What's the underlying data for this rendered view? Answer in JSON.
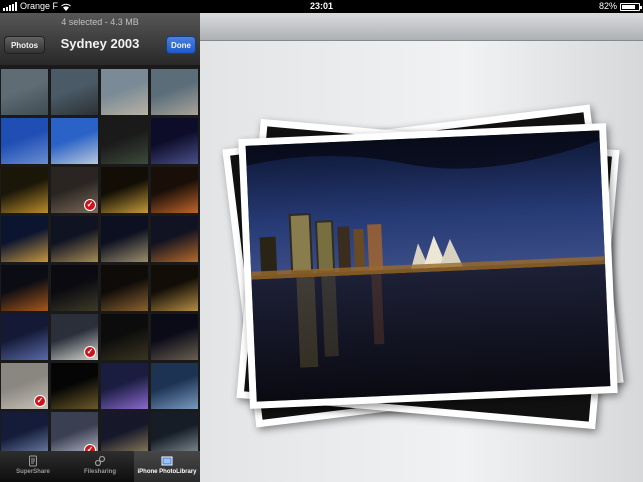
{
  "status_bar": {
    "carrier": "Orange F",
    "time": "23:01",
    "battery": "82%",
    "battery_level": 0.82
  },
  "nav": {
    "subtitle": "4 selected - 4.3 MB",
    "title": "Sydney 2003",
    "back_label": "Photos",
    "done_label": "Done"
  },
  "tabs": [
    {
      "label": "SuperShare",
      "icon": "document-icon"
    },
    {
      "label": "Filesharing",
      "icon": "link-icon"
    },
    {
      "label": "iPhone PhotoLibrary",
      "icon": "photo-library-icon"
    }
  ],
  "active_tab": 2,
  "photos": [
    {
      "colors": [
        "#5f6c74",
        "#3f4a52"
      ],
      "selected": false
    },
    {
      "colors": [
        "#4a5a66",
        "#2b3133"
      ],
      "selected": false
    },
    {
      "colors": [
        "#7a8a96",
        "#b7b2a4"
      ],
      "selected": false
    },
    {
      "colors": [
        "#5b6d79",
        "#a7a49a"
      ],
      "selected": false
    },
    {
      "colors": [
        "#1f4fb5",
        "#6c8ed0"
      ],
      "selected": false
    },
    {
      "colors": [
        "#2a62c7",
        "#b7c8db"
      ],
      "selected": false
    },
    {
      "colors": [
        "#1a1a1a",
        "#3d4a3a"
      ],
      "selected": false
    },
    {
      "colors": [
        "#0d0d2a",
        "#4b4f8a"
      ],
      "selected": false
    },
    {
      "colors": [
        "#1b1708",
        "#b98d2c"
      ],
      "selected": false
    },
    {
      "colors": [
        "#2a2522",
        "#7a6a5a"
      ],
      "selected": true
    },
    {
      "colors": [
        "#120e05",
        "#c49a3a"
      ],
      "selected": false
    },
    {
      "colors": [
        "#1a0f08",
        "#c0662a"
      ],
      "selected": false
    },
    {
      "colors": [
        "#0c1530",
        "#c59740"
      ],
      "selected": false
    },
    {
      "colors": [
        "#0f1322",
        "#a58a55"
      ],
      "selected": false
    },
    {
      "colors": [
        "#0c1020",
        "#9c8d6b"
      ],
      "selected": false
    },
    {
      "colors": [
        "#111222",
        "#b46a2a"
      ],
      "selected": false
    },
    {
      "colors": [
        "#0c0c14",
        "#a6581c"
      ],
      "selected": false
    },
    {
      "colors": [
        "#0a0a10",
        "#3e3a28"
      ],
      "selected": false
    },
    {
      "colors": [
        "#0e0b08",
        "#8a6232"
      ],
      "selected": false
    },
    {
      "colors": [
        "#120e07",
        "#b48d45"
      ],
      "selected": false
    },
    {
      "colors": [
        "#141a36",
        "#5a6aa8"
      ],
      "selected": false
    },
    {
      "colors": [
        "#2a2f3a",
        "#d6d6d0"
      ],
      "selected": true
    },
    {
      "colors": [
        "#0c0c0c",
        "#3a3520"
      ],
      "selected": false
    },
    {
      "colors": [
        "#0b0b18",
        "#6a6050"
      ],
      "selected": false
    },
    {
      "colors": [
        "#8a8780",
        "#c9c4ba"
      ],
      "selected": true
    },
    {
      "colors": [
        "#050505",
        "#6b5a2a"
      ],
      "selected": false
    },
    {
      "colors": [
        "#1b1d40",
        "#8a6acf"
      ],
      "selected": false
    },
    {
      "colors": [
        "#1d3354",
        "#7a9ac0"
      ],
      "selected": false
    },
    {
      "colors": [
        "#141c3a",
        "#7a8ab0"
      ],
      "selected": false
    },
    {
      "colors": [
        "#3a3f52",
        "#c5c8d5"
      ],
      "selected": true
    },
    {
      "colors": [
        "#16182a",
        "#9a8a60"
      ],
      "selected": false
    },
    {
      "colors": [
        "#161d26",
        "#8c9aa0"
      ],
      "selected": false
    }
  ]
}
